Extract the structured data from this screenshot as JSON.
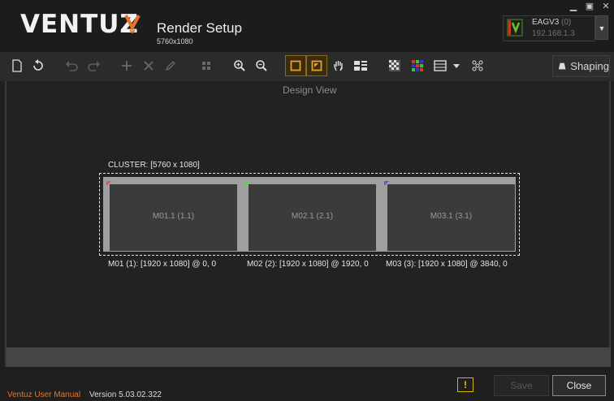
{
  "header": {
    "logo_text": "VENTUZ",
    "title": "Render Setup",
    "subtitle": "5760x1080",
    "window_controls": [
      "▁",
      "▣",
      "✕"
    ],
    "device": {
      "name": "EAGV3",
      "count": "(0)",
      "ip": "192.168.1.3",
      "dropdown": "▼"
    }
  },
  "toolbar": {
    "icons": [
      "new-document-icon",
      "reset-icon",
      "undo-icon",
      "redo-icon",
      "add-icon",
      "delete-icon",
      "edit-icon",
      "grid-icon",
      "zoom-in-icon",
      "zoom-out-icon",
      "select-frame-icon",
      "select-corner-icon",
      "pan-hand-icon",
      "layout-list-icon",
      "checker-pattern-icon",
      "color-grid-icon",
      "test-pattern-icon",
      "dropdown-arrow-icon",
      "dot-pattern-icon"
    ],
    "shaping_label": "Shaping"
  },
  "main": {
    "view_label": "Design View",
    "cluster_label": "CLUSTER: [5760 x 1080]",
    "monitors": [
      {
        "label": "M01.1 (1.1)",
        "caption": "M01 (1): [1920 x 1080] @ 0, 0",
        "corner_color": "#d45a5a"
      },
      {
        "label": "M02.1 (2.1)",
        "caption": "M02 (2): [1920 x 1080] @ 1920, 0",
        "corner_color": "#5ad45a"
      },
      {
        "label": "M03.1 (3.1)",
        "caption": "M03 (3): [1920 x 1080] @ 3840, 0",
        "corner_color": "#5a5ad4"
      }
    ]
  },
  "footer": {
    "manual_link": "Ventuz User Manual",
    "version": "Version 5.03.02.322",
    "warning": "!",
    "save_label": "Save",
    "close_label": "Close"
  },
  "colors": {
    "accent": "#e8742a",
    "active_border": "#8a6a1f",
    "warning": "#e4c400"
  }
}
